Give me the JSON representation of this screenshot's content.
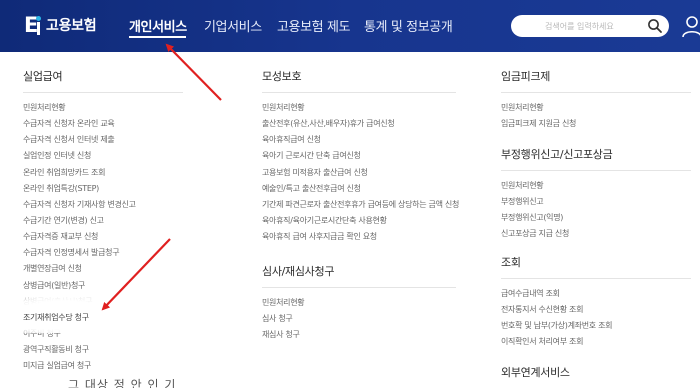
{
  "header": {
    "logo_text": "고용보험",
    "nav": [
      {
        "label": "개인서비스",
        "active": true
      },
      {
        "label": "기업서비스",
        "active": false
      },
      {
        "label": "고용보험 제도",
        "active": false
      },
      {
        "label": "통계 및 정보공개",
        "active": false
      }
    ],
    "search_placeholder": "검색어를 입력하세요"
  },
  "columns": {
    "left": {
      "title": "실업급여",
      "items": [
        "민원처리현황",
        "수급자격 신청자 온라인 교육",
        "수급자격 신청서 인터넷 제출",
        "실업인정 인터넷 신청",
        "온라인 취업희망카드 조회",
        "온라인 취업특강(STEP)",
        "수급자격 신청자 기재사항 변경신고",
        "수급기간 연기(변경) 신고",
        "수급자격증 재교부 신청",
        "수급자격 인정명세서 발급청구",
        "개별연장급여 신청",
        "상병급여(일반)청구",
        "상병급여(출산시)청구",
        "조기재취업수당 청구",
        "이주비 청구",
        "광역구직활동비 청구",
        "미지급 실업급여 청구"
      ],
      "highlighted_index": 13
    },
    "middle": {
      "sections": [
        {
          "title": "모성보호",
          "items": [
            "민원처리현황",
            "출산전후(유산,사산,배우자)휴가 급여신청",
            "육아휴직급여 신청",
            "육아기 근로시간 단축 급여신청",
            "고용보험 미적용자 출산급여 신청",
            "예술인/특고 출산전후급여 신청",
            "기간제 파견근로자 출산전후휴가 급여등에 상당하는 금액 신청",
            "육아휴직/육아기근로시간단축 사용현황",
            "육아휴직 급여 사후지급금 확인 요청"
          ]
        },
        {
          "title": "심사/재심사청구",
          "items": [
            "민원처리현황",
            "심사 청구",
            "재심사 청구"
          ]
        }
      ]
    },
    "right": {
      "sections": [
        {
          "title": "임금피크제",
          "items": [
            "민원처리현황",
            "임금피크제 지원금 신청"
          ]
        },
        {
          "title": "부정행위신고/신고포상금",
          "items": [
            "민원처리현황",
            "부정행위신고",
            "부정행위신고(익명)",
            "신고포상금 지급 신청"
          ]
        },
        {
          "title": "조회",
          "items": [
            "급여수급내역 조회",
            "전자통지서 수신현황 조회",
            "번호확 및 납부(가상)계좌번호 조회",
            "이직확인서 처리여부 조회"
          ]
        },
        {
          "title": "외부연계서비스",
          "items": []
        }
      ]
    }
  },
  "footer_text": "그 대상 정 안 인 기",
  "colors": {
    "header_bg": "#17358e",
    "arrow": "#e02020",
    "text_muted": "#666666"
  }
}
